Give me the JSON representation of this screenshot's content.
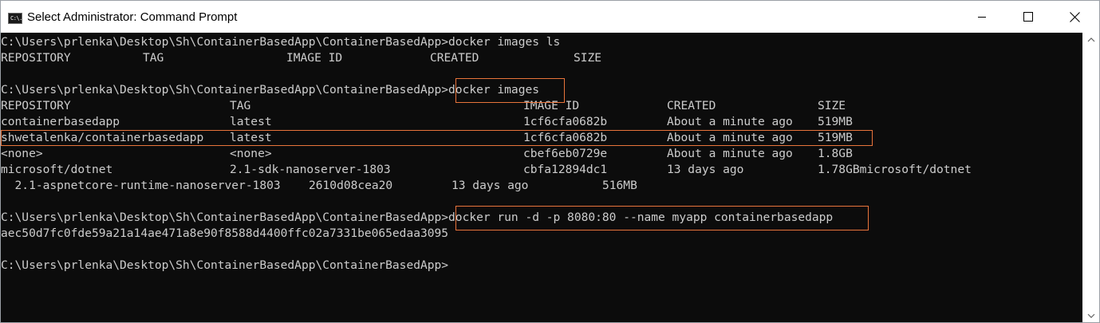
{
  "window": {
    "title": "Select Administrator: Command Prompt",
    "icon_label": "C:\\."
  },
  "console": {
    "lines": [
      {
        "cols": [
          "C:\\Users\\prlenka\\Desktop\\Sh\\ContainerBasedApp\\ContainerBasedApp>docker images ls"
        ]
      },
      {
        "cols": [
          "REPOSITORY",
          "TAG",
          "IMAGE ID",
          "CREATED",
          "SIZE"
        ]
      },
      {
        "cols": [
          ""
        ]
      },
      {
        "cols": [
          "C:\\Users\\prlenka\\Desktop\\Sh\\ContainerBasedApp\\ContainerBasedApp>docker images"
        ]
      },
      {
        "cols": [
          "REPOSITORY",
          "TAG",
          "IMAGE ID",
          "CREATED",
          "SIZE"
        ]
      },
      {
        "cols": [
          "containerbasedapp",
          "latest",
          "1cf6cfa0682b",
          "About a minute ago",
          "519MB"
        ]
      },
      {
        "cols": [
          "shwetalenka/containerbasedapp",
          "latest",
          "1cf6cfa0682b",
          "About a minute ago",
          "519MB"
        ]
      },
      {
        "cols": [
          "<none>",
          "<none>",
          "cbef6eb0729e",
          "About a minute ago",
          "1.8GB"
        ]
      },
      {
        "cols": [
          "microsoft/dotnet",
          "2.1-sdk-nanoserver-1803",
          "cbfa12894dc1",
          "13 days ago",
          "1.78GBmicrosoft/dotnet"
        ]
      },
      {
        "cols": [
          "  2.1-aspnetcore-runtime-nanoserver-1803",
          "2610d08cea20",
          "13 days ago",
          "516MB"
        ]
      },
      {
        "cols": [
          ""
        ]
      },
      {
        "cols": [
          "C:\\Users\\prlenka\\Desktop\\Sh\\ContainerBasedApp\\ContainerBasedApp>docker run -d -p 8080:80 --name myapp containerbasedapp"
        ]
      },
      {
        "cols": [
          "aec50d7fc0fde59a21a14ae471a8e90f8588d4400ffc02a7331be065edaa3095"
        ]
      },
      {
        "cols": [
          ""
        ]
      },
      {
        "cols": [
          "C:\\Users\\prlenka\\Desktop\\Sh\\ContainerBasedApp\\ContainerBasedApp>"
        ]
      }
    ]
  },
  "colors": {
    "console_bg": "#0c0c0c",
    "console_text": "#cccccc",
    "highlight_border": "#e8743b",
    "titlebar_bg": "#ffffff"
  }
}
